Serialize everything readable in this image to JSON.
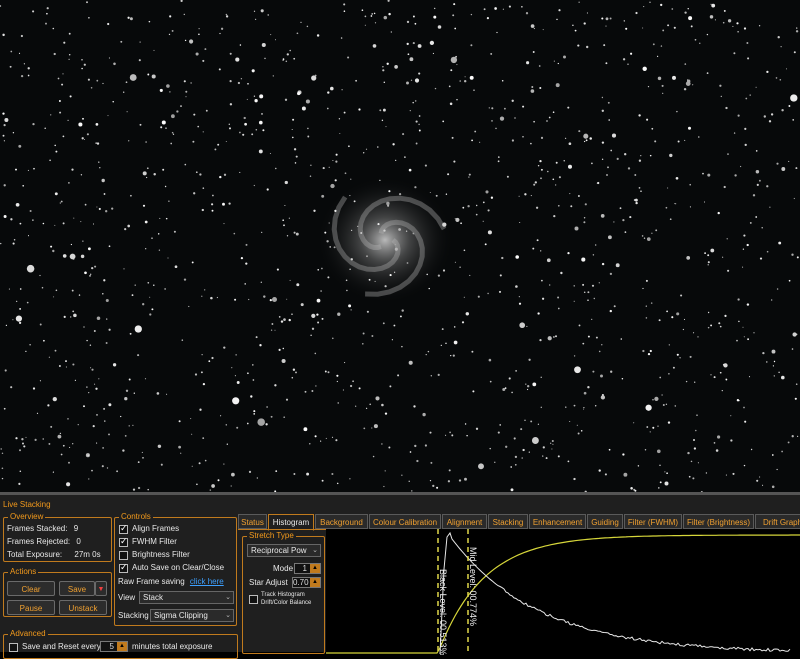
{
  "panel": {
    "title": "Live Stacking"
  },
  "overview": {
    "legend": "Overview",
    "frames_stacked_label": "Frames Stacked:",
    "frames_stacked": "9",
    "frames_rejected_label": "Frames Rejected:",
    "frames_rejected": "0",
    "total_exposure_label": "Total Exposure:",
    "total_exposure": "27m 0s"
  },
  "actions": {
    "legend": "Actions",
    "clear": "Clear",
    "save": "Save",
    "pause": "Pause",
    "unstack": "Unstack"
  },
  "advanced": {
    "legend": "Advanced",
    "save_reset_label": "Save and Reset every",
    "save_reset_value": "5",
    "save_reset_suffix": "minutes total exposure"
  },
  "controls": {
    "legend": "Controls",
    "align_frames": "Align Frames",
    "align_frames_checked": true,
    "fwhm_filter": "FWHM Filter",
    "fwhm_filter_checked": true,
    "brightness_filter": "Brightness Filter",
    "brightness_filter_checked": false,
    "auto_save": "Auto Save on Clear/Close",
    "auto_save_checked": true,
    "raw_saving_label": "Raw Frame saving",
    "raw_saving_link": "click here",
    "view_label": "View",
    "view_value": "Stack",
    "stacking_label": "Stacking",
    "stacking_value": "Sigma Clipping"
  },
  "tabs": [
    {
      "label": "Status"
    },
    {
      "label": "Histogram",
      "active": true
    },
    {
      "label": "Background"
    },
    {
      "label": "Colour Calibration"
    },
    {
      "label": "Alignment"
    },
    {
      "label": "Stacking"
    },
    {
      "label": "Enhancement"
    },
    {
      "label": "Guiding"
    },
    {
      "label": "Filter (FWHM)"
    },
    {
      "label": "Filter (Brightness)"
    },
    {
      "label": "Drift Graph"
    }
  ],
  "stretch": {
    "legend": "Stretch Type",
    "type_value": "Reciprocal Pow",
    "mode_label": "Mode",
    "mode_value": "1",
    "star_adjust_label": "Star Adjust",
    "star_adjust_value": "0.70",
    "track_label_1": "Track Histogram",
    "track_label_2": "Drift/Color Balance"
  },
  "histogram": {
    "black_level_label": "Black Level: 00.513%",
    "mid_level_label": "Mid Level: 00.774%",
    "black_level_pct": 0.513,
    "mid_level_pct": 0.774,
    "colors": {
      "curve": "#d6d63a",
      "histogram": "#e8e8e8",
      "markers": "#e0d84a"
    }
  },
  "colors": {
    "accent": "#f39a1c",
    "border": "#c07a1d",
    "panel_bg": "#1f1f1f",
    "link": "#3da0ff"
  }
}
